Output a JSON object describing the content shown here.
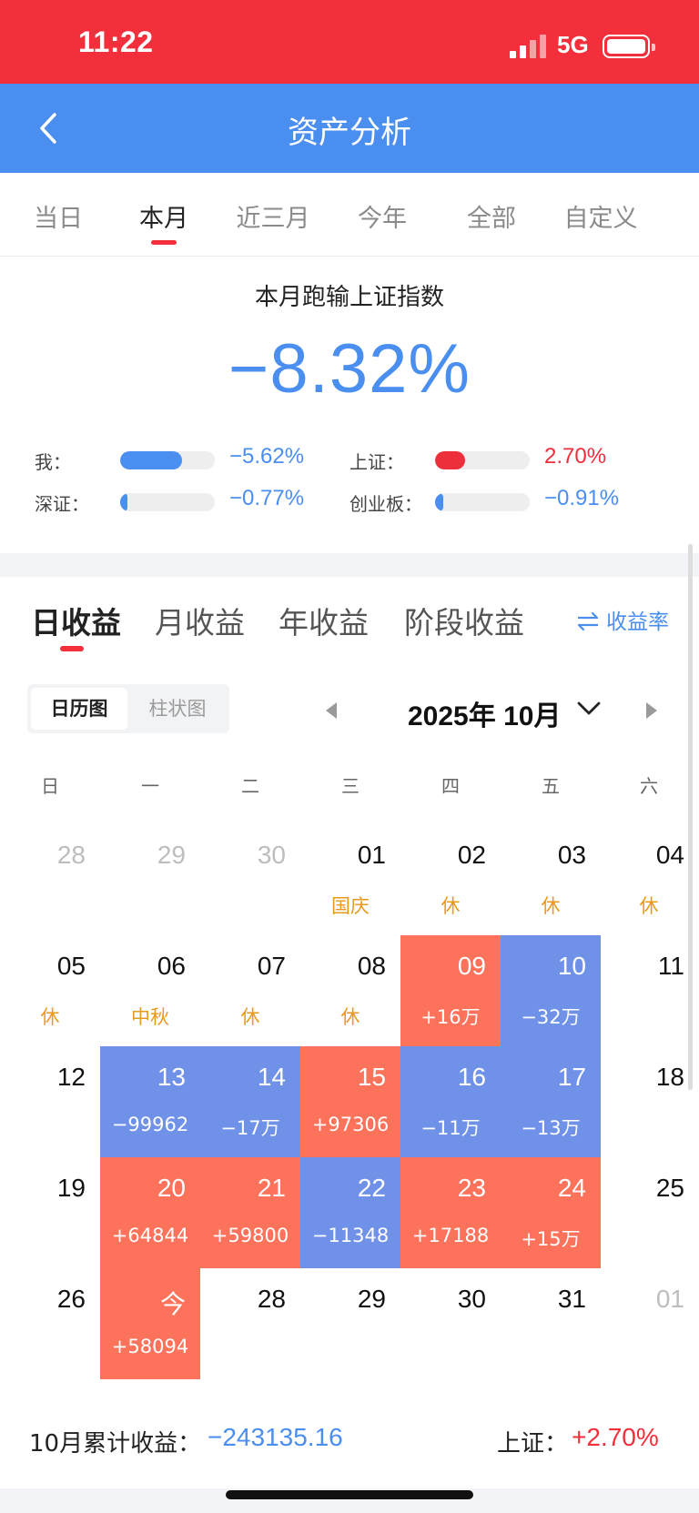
{
  "status_bar": {
    "time": "11:22",
    "network": "5G",
    "icons": [
      "signal-icon",
      "battery-icon"
    ]
  },
  "nav": {
    "title": "资产分析",
    "back_icon": "chevron-left-icon"
  },
  "period_tabs": [
    {
      "label": "当日",
      "active": false
    },
    {
      "label": "本月",
      "active": true
    },
    {
      "label": "近三月",
      "active": false
    },
    {
      "label": "今年",
      "active": false
    },
    {
      "label": "全部",
      "active": false
    },
    {
      "label": "自定义",
      "active": false
    }
  ],
  "compare": {
    "title": "本月跑输上证指数",
    "value": "−8.32%",
    "rows": [
      {
        "label": "我：",
        "value": "−5.62%",
        "fill": 0.65,
        "color": "#4a8ef0"
      },
      {
        "label": "上证：",
        "value": "2.70%",
        "fill": 0.32,
        "color": "#ec2f3b"
      },
      {
        "label": "深证：",
        "value": "−0.77%",
        "fill": 0.08,
        "color": "#4a8ef0"
      },
      {
        "label": "创业板：",
        "value": "−0.91%",
        "fill": 0.09,
        "color": "#4a8ef0"
      }
    ]
  },
  "profit_tabs": [
    {
      "label": "日收益",
      "active": true
    },
    {
      "label": "月收益",
      "active": false
    },
    {
      "label": "年收益",
      "active": false
    },
    {
      "label": "阶段收益",
      "active": false
    }
  ],
  "rate_link": {
    "label": "收益率",
    "icon": "swap-icon"
  },
  "view_toggle": {
    "calendar": "日历图",
    "bar": "柱状图",
    "active": "calendar"
  },
  "month": {
    "label": "2025年 10月",
    "prev_icon": "triangle-left-icon",
    "next_icon": "triangle-right-icon",
    "dropdown_icon": "chevron-down-icon"
  },
  "weekdays": [
    "日",
    "一",
    "二",
    "三",
    "四",
    "五",
    "六"
  ],
  "calendar": [
    [
      {
        "day": "28",
        "sub": "",
        "kind": "other"
      },
      {
        "day": "29",
        "sub": "",
        "kind": "other"
      },
      {
        "day": "30",
        "sub": "",
        "kind": "other"
      },
      {
        "day": "01",
        "sub": "国庆",
        "kind": "holiday"
      },
      {
        "day": "02",
        "sub": "休",
        "kind": "holiday"
      },
      {
        "day": "03",
        "sub": "休",
        "kind": "holiday"
      },
      {
        "day": "04",
        "sub": "休",
        "kind": "holiday"
      }
    ],
    [
      {
        "day": "05",
        "sub": "休",
        "kind": "holiday"
      },
      {
        "day": "06",
        "sub": "中秋",
        "kind": "holiday"
      },
      {
        "day": "07",
        "sub": "休",
        "kind": "holiday"
      },
      {
        "day": "08",
        "sub": "休",
        "kind": "holiday"
      },
      {
        "day": "09",
        "sub": "+16万",
        "kind": "gain"
      },
      {
        "day": "10",
        "sub": "−32万",
        "kind": "loss"
      },
      {
        "day": "11",
        "sub": "",
        "kind": "normal"
      }
    ],
    [
      {
        "day": "12",
        "sub": "",
        "kind": "normal"
      },
      {
        "day": "13",
        "sub": "−99962",
        "kind": "loss"
      },
      {
        "day": "14",
        "sub": "−17万",
        "kind": "loss"
      },
      {
        "day": "15",
        "sub": "+97306",
        "kind": "gain"
      },
      {
        "day": "16",
        "sub": "−11万",
        "kind": "loss"
      },
      {
        "day": "17",
        "sub": "−13万",
        "kind": "loss"
      },
      {
        "day": "18",
        "sub": "",
        "kind": "normal"
      }
    ],
    [
      {
        "day": "19",
        "sub": "",
        "kind": "normal"
      },
      {
        "day": "20",
        "sub": "+64844",
        "kind": "gain"
      },
      {
        "day": "21",
        "sub": "+59800",
        "kind": "gain"
      },
      {
        "day": "22",
        "sub": "−11348",
        "kind": "loss"
      },
      {
        "day": "23",
        "sub": "+17188",
        "kind": "gain"
      },
      {
        "day": "24",
        "sub": "+15万",
        "kind": "gain"
      },
      {
        "day": "25",
        "sub": "",
        "kind": "normal"
      }
    ],
    [
      {
        "day": "26",
        "sub": "",
        "kind": "normal"
      },
      {
        "day": "今",
        "sub": "+58094",
        "kind": "gain"
      },
      {
        "day": "28",
        "sub": "",
        "kind": "normal"
      },
      {
        "day": "29",
        "sub": "",
        "kind": "normal"
      },
      {
        "day": "30",
        "sub": "",
        "kind": "normal"
      },
      {
        "day": "31",
        "sub": "",
        "kind": "normal"
      },
      {
        "day": "01",
        "sub": "",
        "kind": "other"
      }
    ]
  ],
  "summary": {
    "label": "10月累计收益：",
    "value": "−243135.16",
    "index_label": "上证：",
    "index_value": "+2.70%"
  },
  "colors": {
    "status_red": "#f22f3b",
    "nav_blue": "#4a8ef0",
    "gain": "#fd725b",
    "loss": "#6f92e8",
    "holiday_text": "#e79a1c"
  }
}
